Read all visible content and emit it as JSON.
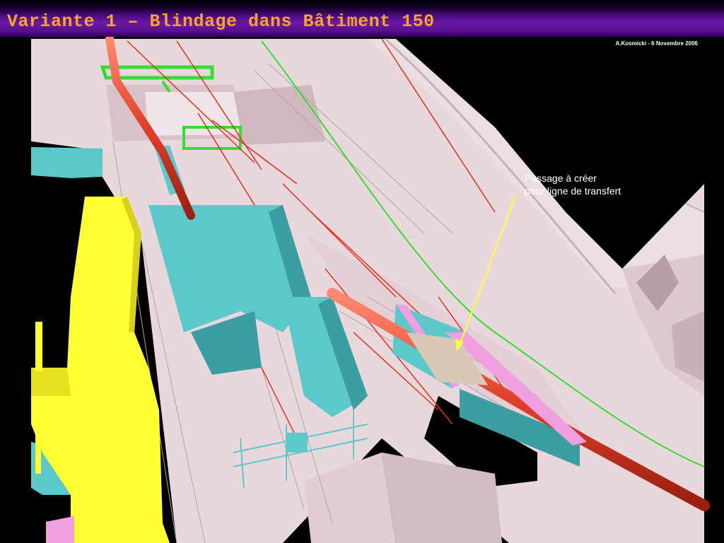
{
  "slide": {
    "title": "Variante 1 – Blindage dans Bâtiment 150",
    "author": "A.Kosmicki - 6 Novembre 2006",
    "annotation": {
      "line1": "Passage à créer",
      "line2": "pour ligne de transfert"
    }
  },
  "colors": {
    "title_text": "#f5a623",
    "title_bar": "#5a1090",
    "structure": "#e8d8dc",
    "shielding": "#5cc8cc",
    "beam_pipe": "#e0402a",
    "yellow_block": "#ffff33",
    "pink_element": "#f0a0e0",
    "green_line": "#33dd33",
    "arrow": "#ffff33"
  }
}
